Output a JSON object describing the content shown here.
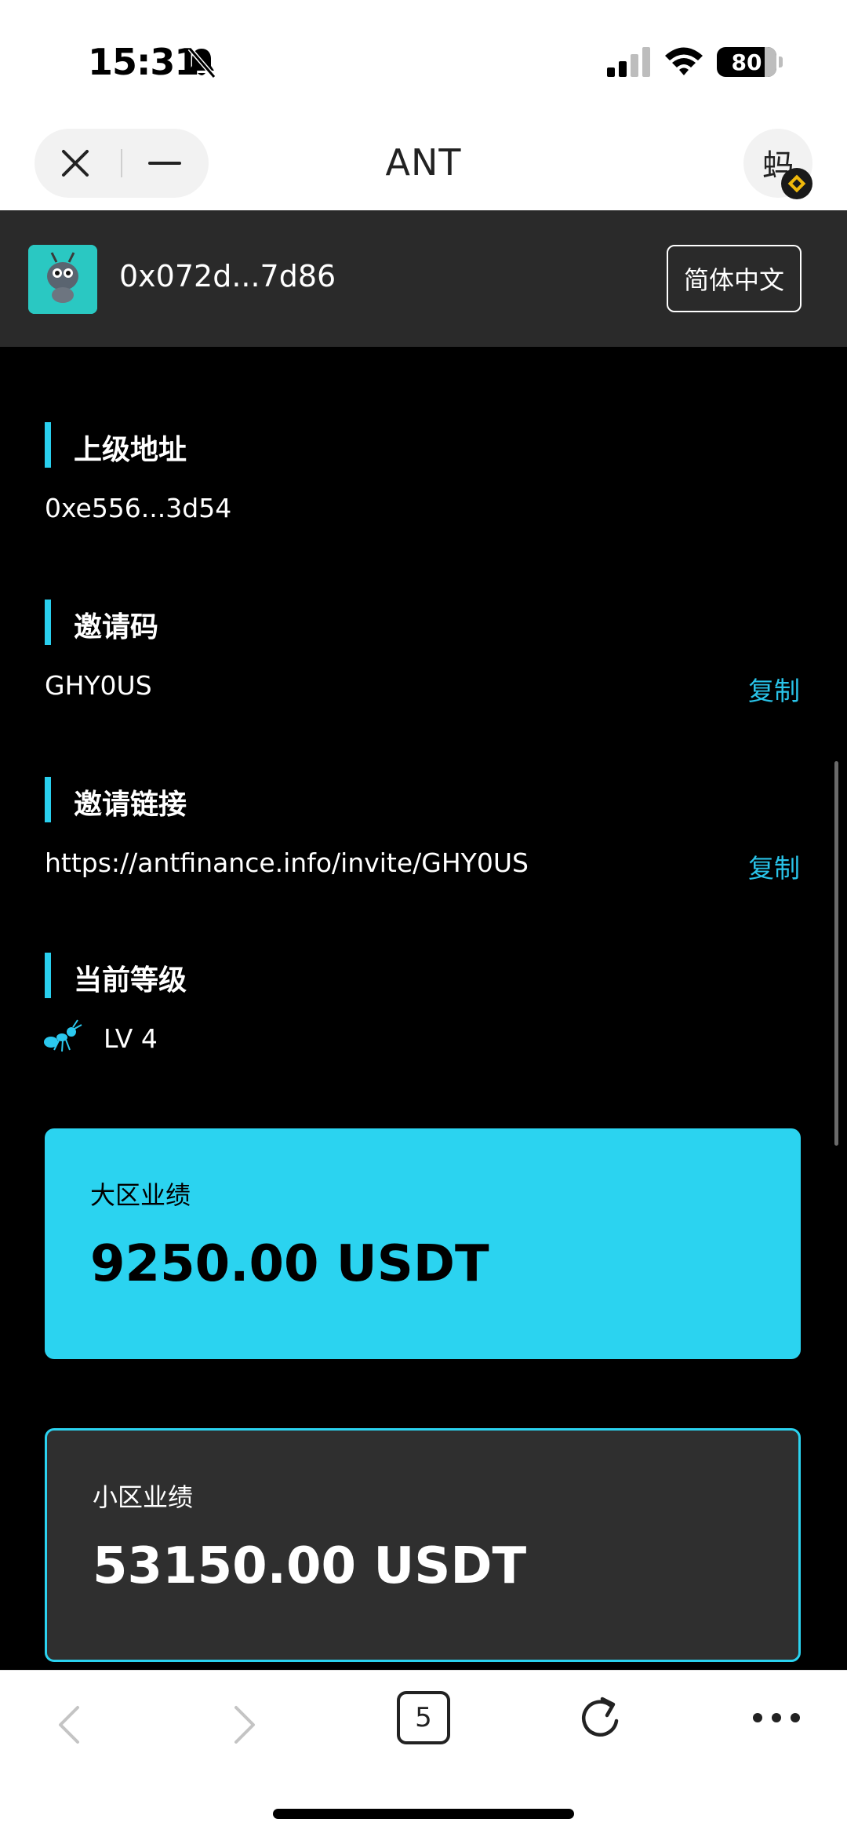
{
  "status_bar": {
    "time": "15:31",
    "battery_level": "80",
    "battery_fraction": 0.8
  },
  "header": {
    "title": "ANT",
    "avatar_char": "蚂"
  },
  "account": {
    "address": "0x072d...7d86",
    "language_label": "简体中文"
  },
  "sections": {
    "parent_address": {
      "title": "上级地址",
      "value": "0xe556...3d54"
    },
    "invite_code": {
      "title": "邀请码",
      "value": "GHY0US",
      "copy_label": "复制"
    },
    "invite_link": {
      "title": "邀请链接",
      "value": "https://antfinance.info/invite/GHY0US",
      "copy_label": "复制"
    },
    "level": {
      "title": "当前等级",
      "value": "LV 4"
    }
  },
  "cards": {
    "major": {
      "label": "大区业绩",
      "amount": "9250.00 USDT"
    },
    "minor": {
      "label": "小区业绩",
      "amount": "53150.00 USDT"
    }
  },
  "bottom_bar": {
    "tab_count": "5"
  },
  "colors": {
    "accent": "#2bd3f0",
    "link": "#29c3e8",
    "background": "#000000",
    "topbar": "#2a2a2a",
    "card_dark": "#2f2f2f"
  },
  "icons": {
    "status": [
      "bell-off-icon",
      "signal-icon",
      "wifi-icon",
      "battery-icon"
    ],
    "header": [
      "close-icon",
      "minimize-icon",
      "avatar"
    ],
    "level": "ant-icon",
    "bottom": [
      "back-icon",
      "forward-icon",
      "tabs-icon",
      "reload-icon",
      "more-icon"
    ]
  }
}
